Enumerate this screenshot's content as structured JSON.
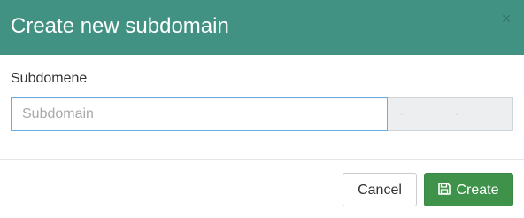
{
  "modal": {
    "title": "Create new subdomain",
    "close_icon": "close-icon",
    "close_glyph": "×"
  },
  "form": {
    "label": "Subdomene",
    "input_value": "",
    "input_placeholder": "Subdomain",
    "domain_suffix": "· ·"
  },
  "footer": {
    "cancel_label": "Cancel",
    "create_label": "Create",
    "create_icon": "save-icon"
  },
  "colors": {
    "header_bg": "#419282",
    "create_bg": "#3f9249",
    "input_focus_border": "#66afe9"
  }
}
